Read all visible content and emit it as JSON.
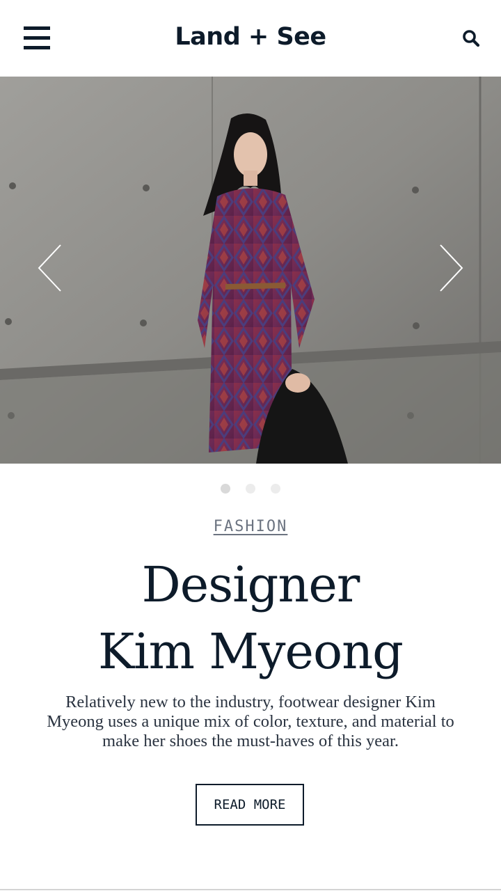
{
  "header": {
    "menu_icon": "hamburger-menu-icon",
    "title": "Land + See",
    "search_icon": "search-icon"
  },
  "hero": {
    "image_description": "woman in patterned dress in front of concrete wall",
    "prev_icon": "chevron-left-icon",
    "next_icon": "chevron-right-icon",
    "slides_count": 3,
    "active_slide": 1
  },
  "article": {
    "category": "FASHION",
    "headline_line1": "Designer",
    "headline_line2": "Kim Myeong",
    "excerpt": "Relatively new to the industry, footwear designer Kim Myeong uses a unique mix of color, texture, and material to make her shoes the must-haves of this year.",
    "read_more_label": "READ MORE"
  },
  "colors": {
    "text_dark": "#0d1b2a",
    "category_gray": "#6b7380",
    "dot_active": "#d9d9d9",
    "dot_inactive": "#ececec"
  }
}
